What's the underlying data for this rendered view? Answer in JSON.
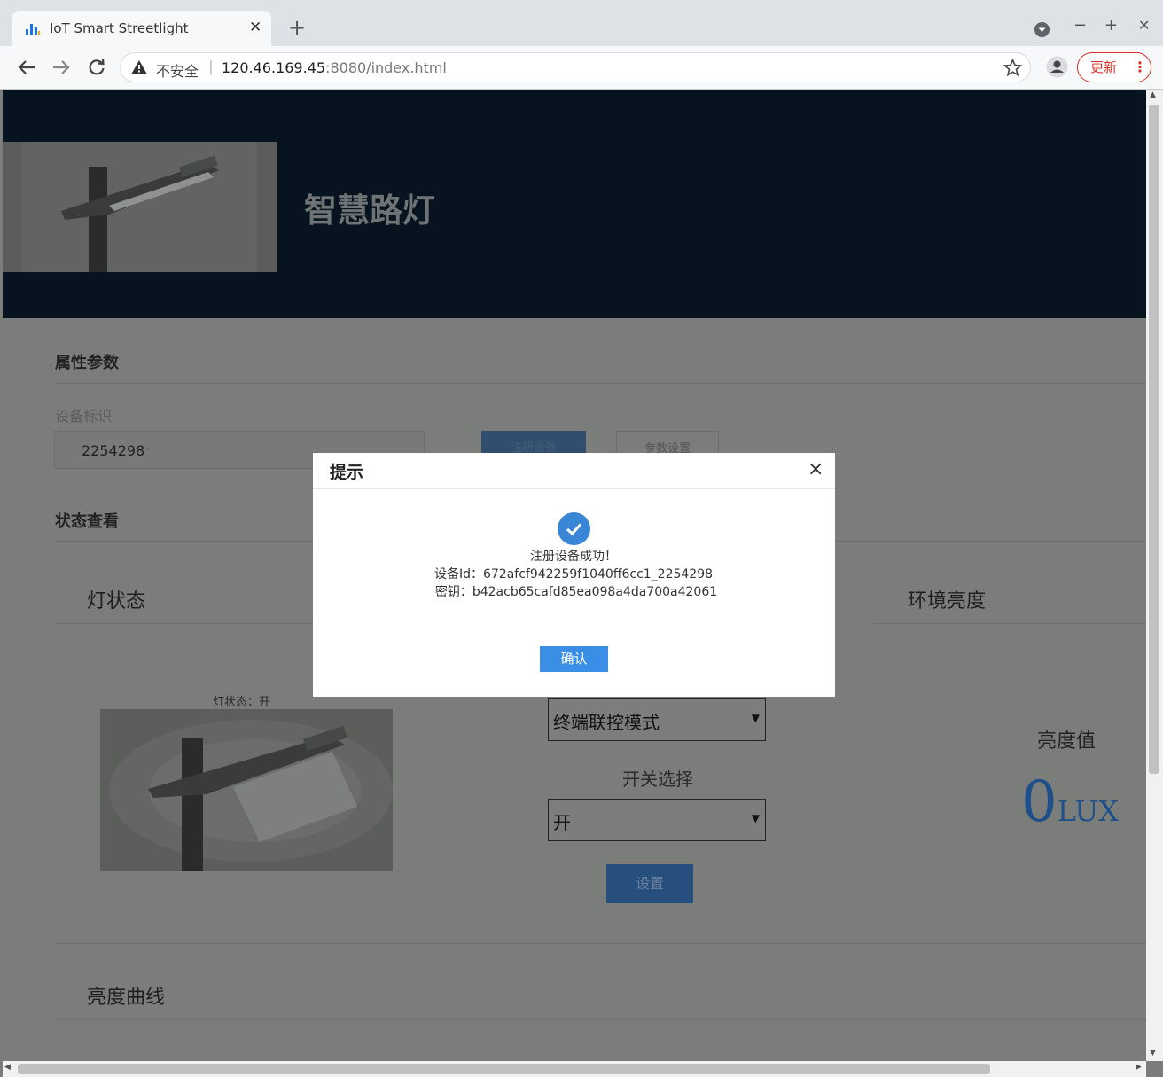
{
  "browser": {
    "tab_title": "IoT Smart Streetlight",
    "tab_close": "✕",
    "new_tab": "+",
    "security_label": "不安全",
    "url_host": "120.46.169.45",
    "url_path": ":8080/index.html",
    "update_label": "更新",
    "window_minimize": "−",
    "window_maximize": "+",
    "window_close": "✕"
  },
  "header": {
    "title": "智慧路灯"
  },
  "properties": {
    "section_title": "属性参数",
    "device_id_label": "设备标识",
    "device_id_value": "2254298",
    "register_button": "注册设备",
    "param_button": "参数设置"
  },
  "status": {
    "section_title": "状态查看",
    "lamp_panel_title": "灯状态",
    "lamp_status_text": "灯状态：开",
    "mode_select_value": "终端联控模式",
    "switch_label": "开关选择",
    "switch_select_value": "开",
    "set_button": "设置",
    "env_panel_title": "环境亮度",
    "lux_label": "亮度值",
    "lux_value": "0",
    "lux_unit": "LUX"
  },
  "curve": {
    "title": "亮度曲线"
  },
  "modal": {
    "title": "提示",
    "close": "×",
    "message": "注册设备成功！",
    "device_id_line": "设备Id：672afcf942259f1040ff6cc1_2254298",
    "secret_line": "密钥：b42acb65cafd85ea098a4da700a42061",
    "ok_button": "确认"
  },
  "colors": {
    "accent": "#3a8ee6",
    "header_bg": "#07131f",
    "overlay_page": "#7a7d79",
    "success": "#3a86d6"
  }
}
